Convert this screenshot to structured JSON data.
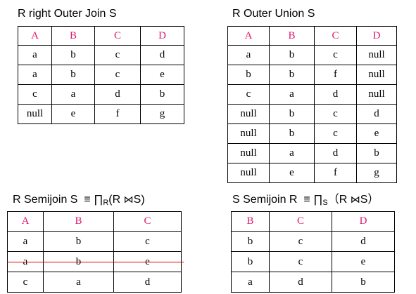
{
  "panels": {
    "right_outer_join": {
      "title": "R right Outer Join S",
      "columns": [
        "A",
        "B",
        "C",
        "D"
      ],
      "rows": [
        [
          "a",
          "b",
          "c",
          "d"
        ],
        [
          "a",
          "b",
          "c",
          "e"
        ],
        [
          "c",
          "a",
          "d",
          "b"
        ],
        [
          "null",
          "e",
          "f",
          "g"
        ]
      ]
    },
    "outer_union": {
      "title": "R Outer Union S",
      "columns": [
        "A",
        "B",
        "C",
        "D"
      ],
      "rows": [
        [
          "a",
          "b",
          "c",
          "null"
        ],
        [
          "b",
          "b",
          "f",
          "null"
        ],
        [
          "c",
          "a",
          "d",
          "null"
        ],
        [
          "null",
          "b",
          "c",
          "d"
        ],
        [
          "null",
          "b",
          "c",
          "e"
        ],
        [
          "null",
          "a",
          "d",
          "b"
        ],
        [
          "null",
          "e",
          "f",
          "g"
        ]
      ]
    },
    "semijoin_rs": {
      "title": {
        "lead": "R Semijoin S",
        "equiv": "≡",
        "pi": "∏",
        "subscript": "R",
        "open": "(R",
        "bowtie": "⋈",
        "close": "S)"
      },
      "columns": [
        "A",
        "B",
        "C"
      ],
      "rows": [
        [
          "a",
          "b",
          "c"
        ],
        [
          "a",
          "b",
          "e"
        ],
        [
          "c",
          "a",
          "d"
        ]
      ],
      "struck_row_index": 1,
      "strike_color": "#e00000"
    },
    "semijoin_sr": {
      "title": {
        "lead": "S Semijoin R",
        "equiv": "≡",
        "pi": "∏",
        "subscript": "S",
        "open": "（R",
        "bowtie": "⋈",
        "close": "S）"
      },
      "columns": [
        "B",
        "C",
        "D"
      ],
      "rows": [
        [
          "b",
          "c",
          "d"
        ],
        [
          "b",
          "c",
          "e"
        ],
        [
          "a",
          "d",
          "b"
        ]
      ]
    }
  },
  "header_color": "#e0186c"
}
